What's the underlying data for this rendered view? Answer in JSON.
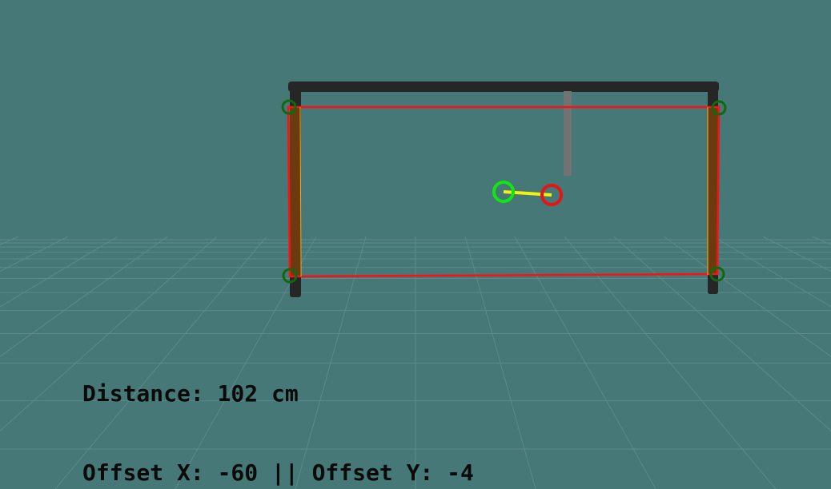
{
  "scene": {
    "background_color": "#457877",
    "grid_color": "#5e8a89",
    "goal_frame_color": "#262626",
    "post_color": "#6b3a10",
    "detection_box_color": "#ff1010",
    "center_marker_color": "#12e612",
    "target_marker_color": "#e81414",
    "offset_line_color": "#f2f20c",
    "corner_marker_color": "#0f6a0f"
  },
  "readouts": {
    "distance_label": "Distance: 102 cm",
    "offset_label": "Offset X: -60 || Offset Y: -4"
  }
}
